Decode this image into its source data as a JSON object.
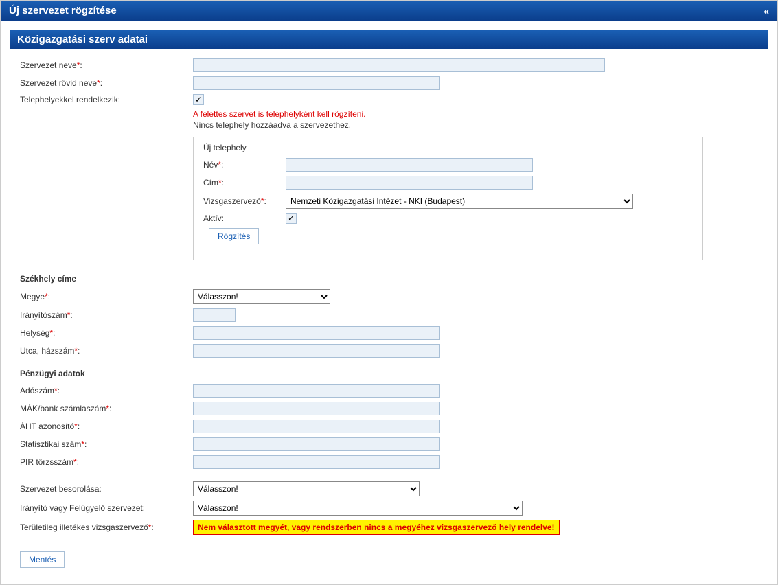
{
  "window": {
    "title": "Új szervezet rögzítése",
    "collapse_icon": "«"
  },
  "section_header": "Közigazgatási szerv adatai",
  "org": {
    "name_label": "Szervezet neve",
    "short_name_label": "Szervezet rövid neve",
    "has_sites_label": "Telephelyekkel rendelkezik:"
  },
  "messages": {
    "warn_parent_site": "A felettes szervet is telephelyként kell rögzíteni.",
    "no_site_added": "Nincs telephely hozzáadva a szervezethez."
  },
  "new_site": {
    "legend": "Új telephely",
    "name_label": "Név",
    "address_label": "Cím",
    "exam_org_label": "Vizsgaszervező",
    "exam_org_value": "Nemzeti Közigazgatási Intézet - NKI (Budapest)",
    "active_label": "Aktív:",
    "save_btn": "Rögzítés"
  },
  "seat": {
    "heading": "Székhely címe",
    "county_label": "Megye",
    "county_value": "Válasszon!",
    "zip_label": "Irányítószám",
    "city_label": "Helység",
    "street_label": "Utca, házszám"
  },
  "finance": {
    "heading": "Pénzügyi adatok",
    "tax_label": "Adószám",
    "bank_label": "MÁK/bank számlaszám",
    "aht_label": "ÁHT azonosító",
    "stat_label": "Statisztikai szám",
    "pir_label": "PIR törzsszám"
  },
  "classification": {
    "category_label": "Szervezet besorolása:",
    "category_value": "Válasszon!",
    "supervisor_label": "Irányító vagy Felügyelő szervezet:",
    "supervisor_value": "Válasszon!",
    "territorial_label": "Területileg illetékes vizsgaszervező",
    "territorial_alert": "Nem választott megyét, vagy rendszerben nincs a megyéhez vizsgaszervező hely rendelve!"
  },
  "save_label": "Mentés"
}
